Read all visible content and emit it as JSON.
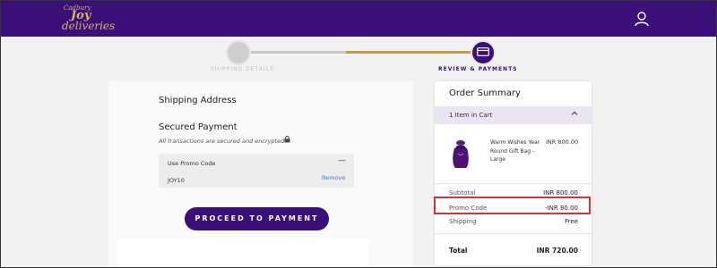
{
  "header": {
    "logo": {
      "brand": "Cadbury",
      "line1": "Joy",
      "line2": "deliveries"
    },
    "user_icon": "user-icon"
  },
  "stepper": {
    "steps": [
      {
        "label": "SHIPPING DETAILS",
        "state": "completed"
      },
      {
        "label": "REVIEW & PAYMENTS",
        "state": "active",
        "icon": "card-icon"
      }
    ],
    "active_color": "#3a0f78",
    "progress_color": "#c99a4a"
  },
  "left": {
    "shipping_title": "Shipping Address",
    "secured_title": "Secured Payment",
    "secured_note": "All transactions are secured and encrypted",
    "promo": {
      "label": "Use Promo Code",
      "collapse_symbol": "—",
      "code": "JOY10",
      "remove_label": "Remove"
    },
    "proceed_label": "PROCEED TO PAYMENT"
  },
  "summary": {
    "title": "Order Summary",
    "cart_label": "1 Item in Cart",
    "product": {
      "name": "Warm Wishes Year Round Gift Bag - Large",
      "price": "INR 800.00"
    },
    "subtotal_label": "Subtotal",
    "subtotal_value": "INR 800.00",
    "promo_label": "Promo Code",
    "promo_value": "-INR 80.00",
    "shipping_label": "Shipping",
    "shipping_value": "Free",
    "total_label": "Total",
    "total_value": "INR 720.00"
  }
}
